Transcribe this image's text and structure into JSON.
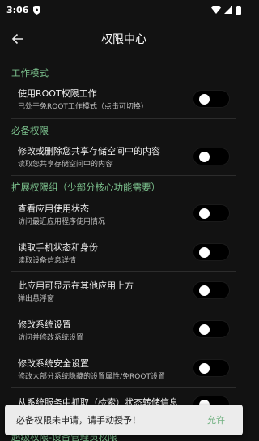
{
  "status": {
    "time": "3:06"
  },
  "header": {
    "title": "权限中心"
  },
  "sections": {
    "work_mode": {
      "label": "工作模式",
      "rows": [
        {
          "title": "使用ROOT权限工作",
          "desc": "已处于免ROOT工作模式（点击可切换）",
          "enabled": false
        }
      ]
    },
    "required": {
      "label": "必备权限",
      "rows": [
        {
          "title": "修改或删除您共享存储空间中的内容",
          "desc": "读取您共享存储空间中的内容",
          "enabled": false
        }
      ]
    },
    "extended": {
      "label": "扩展权限组（少部分核心功能需要）",
      "rows": [
        {
          "title": "查看应用使用状态",
          "desc": "访问最近应用程序使用情况",
          "enabled": false
        },
        {
          "title": "读取手机状态和身份",
          "desc": "读取设备信息详情",
          "enabled": false
        },
        {
          "title": "此应用可显示在其他应用上方",
          "desc": "弹出悬浮窗",
          "enabled": false
        },
        {
          "title": "修改系统设置",
          "desc": "访问并修改系统设置",
          "enabled": false
        },
        {
          "title": "修改系统安全设置",
          "desc": "修改大部分系统隐藏的设置属性/免ROOT设置",
          "enabled": false
        },
        {
          "title": "从系统服务中抓取（检索）状态转储信息",
          "desc": "",
          "enabled": false
        }
      ]
    },
    "super": {
      "label": "超级权限-设备管理员权限"
    }
  },
  "snackbar": {
    "message": "必备权限未申请，请手动授予！",
    "action": "允许"
  },
  "colors": {
    "accent": "#7cc28e",
    "background": "#121212"
  }
}
